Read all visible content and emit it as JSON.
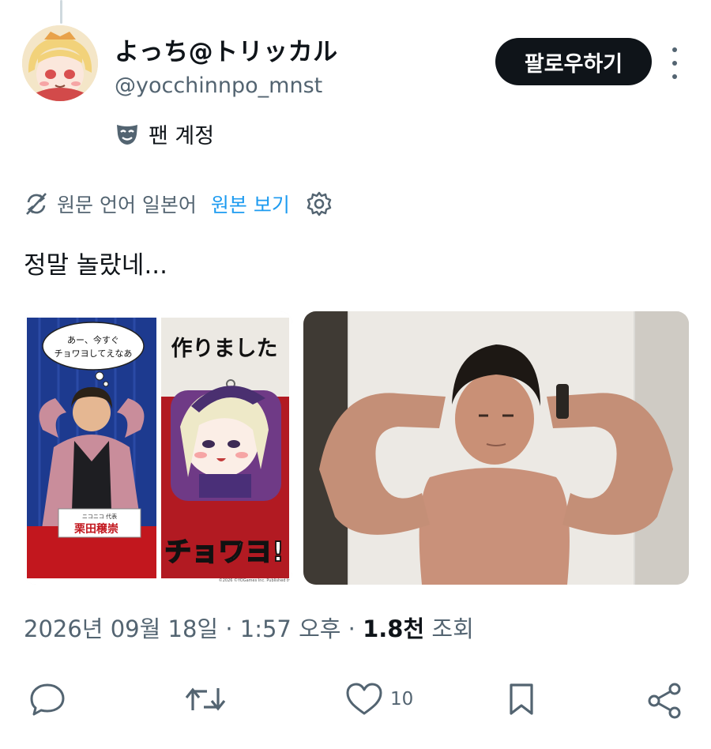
{
  "user": {
    "display_name": "よっち@トリッカル",
    "handle": "@yocchinnpo_mnst",
    "fan_label": "팬 계정",
    "follow_label": "팔로우하기"
  },
  "translate": {
    "source_text": "원문 언어 일본어",
    "link": "원본 보기"
  },
  "tweet": {
    "text": "정말 놀랐네..."
  },
  "media_left": {
    "speech": "あー、今すぐ\nチョワヨしてえなあ",
    "name_plate": "栗田穣崇",
    "name_plate_top": "ニコニコ 代表",
    "headline": "作りました",
    "chowayo": "チョワヨ!",
    "copyright": "©2026 ©YOGames Inc. Published by BLBF"
  },
  "meta": {
    "date": "2026년 09월 18일",
    "sep1": "·",
    "time": "1:57 오후",
    "sep2": "·",
    "views_count": "1.8천",
    "views_label": "조회"
  },
  "actions": {
    "like_count": "10"
  },
  "colors": {
    "accent_blue": "#1d9bf0",
    "text_secondary": "#536471",
    "follow_bg": "#0f1419"
  }
}
